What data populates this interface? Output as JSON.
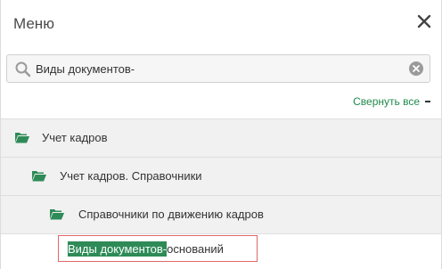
{
  "header": {
    "title": "Меню",
    "close_icon": "close-icon"
  },
  "search": {
    "value": "Виды документов-",
    "search_icon": "search-icon",
    "clear_icon": "clear-icon"
  },
  "tree": {
    "collapse_all_label": "Свернуть все",
    "nodes": [
      {
        "label": "Учет кадров",
        "icon": "folder-open-icon"
      },
      {
        "label": "Учет кадров. Справочники",
        "icon": "folder-open-icon"
      },
      {
        "label": "Справочники по движению кадров",
        "icon": "folder-open-icon"
      }
    ],
    "leaf": {
      "highlight": "Виды документов-",
      "rest": "оснований"
    }
  },
  "colors": {
    "accent_green": "#2e8b57",
    "link_green": "#1f8a4c",
    "row_bg": "#f1f1f1",
    "highlight_border": "#e0676a"
  }
}
